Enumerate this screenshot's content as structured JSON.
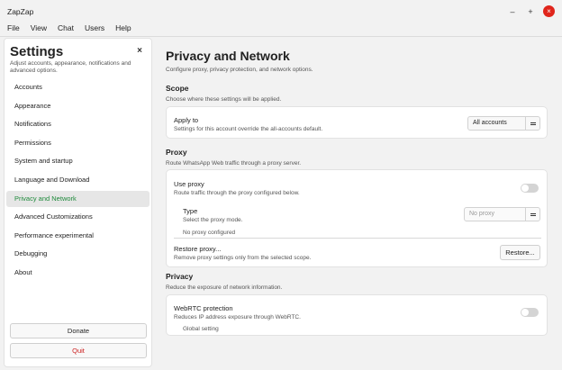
{
  "window": {
    "title": "ZapZap",
    "minimize_icon": "minimize-icon",
    "maximize_icon": "maximize-icon",
    "close_icon": "close-icon",
    "minimize_glyph": "–",
    "maximize_glyph": "+",
    "close_glyph": "×"
  },
  "menu": [
    "File",
    "View",
    "Chat",
    "Users",
    "Help"
  ],
  "sidebar": {
    "title": "Settings",
    "subtitle": "Adjust accounts, appearance, notifications and advanced options.",
    "close_glyph": "×",
    "items": [
      {
        "label": "Accounts"
      },
      {
        "label": "Appearance"
      },
      {
        "label": "Notifications"
      },
      {
        "label": "Permissions"
      },
      {
        "label": "System and startup"
      },
      {
        "label": "Language and Download"
      },
      {
        "label": "Privacy and Network",
        "active": true
      },
      {
        "label": "Advanced Customizations"
      },
      {
        "label": "Performance experimental"
      },
      {
        "label": "Debugging"
      },
      {
        "label": "About"
      }
    ],
    "donate_label": "Donate",
    "quit_label": "Quit",
    "active_color": "#1f8a3c",
    "quit_color": "#cc1f1f"
  },
  "main": {
    "title": "Privacy and Network",
    "subtitle": "Configure proxy, privacy protection, and network options.",
    "scope": {
      "title": "Scope",
      "subtitle": "Choose where these settings will be applied.",
      "apply_label": "Apply to",
      "apply_desc": "Settings for this account override the all-accounts default.",
      "apply_value": "All accounts"
    },
    "proxy": {
      "title": "Proxy",
      "subtitle": "Route WhatsApp Web traffic through a proxy server.",
      "use_label": "Use proxy",
      "use_desc": "Route traffic through the proxy configured below.",
      "use_enabled": false,
      "type_label": "Type",
      "type_desc": "Select the proxy mode.",
      "type_value": "No proxy",
      "status": "No proxy configured",
      "restore_label": "Restore proxy...",
      "restore_desc": "Remove proxy settings only from the selected scope.",
      "restore_button": "Restore..."
    },
    "privacy": {
      "title": "Privacy",
      "subtitle": "Reduce the exposure of network information.",
      "webrtc_label": "WebRTC protection",
      "webrtc_desc": "Reduces IP address exposure through WebRTC.",
      "webrtc_enabled": false,
      "webrtc_note": "Global setting"
    }
  }
}
